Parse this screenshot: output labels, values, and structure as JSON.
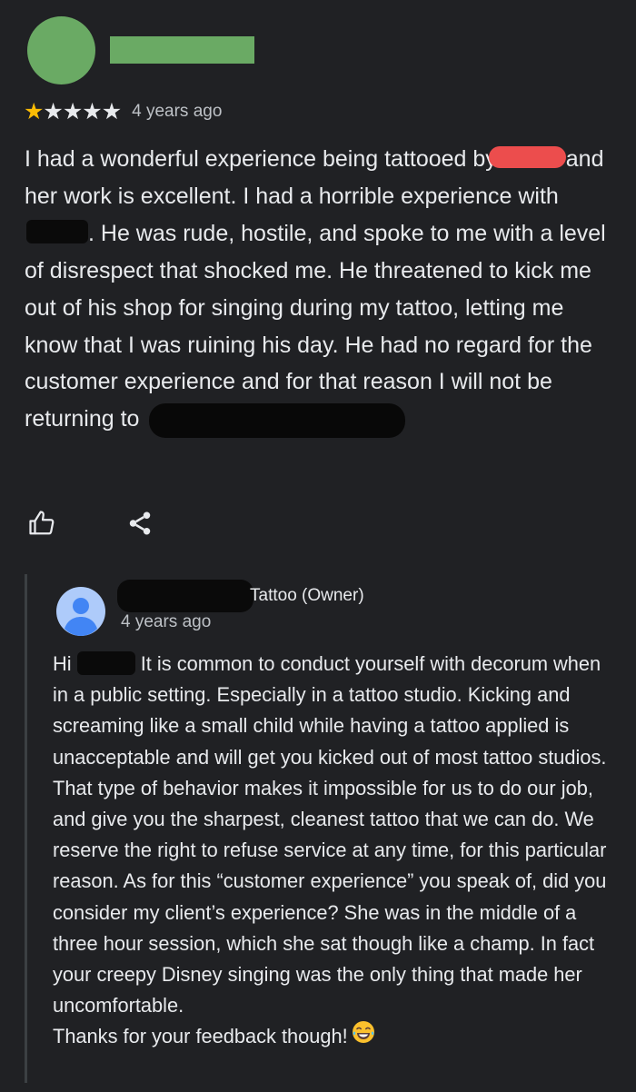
{
  "review": {
    "rating": 1,
    "stars": [
      "★",
      "★",
      "★",
      "★",
      "★"
    ],
    "time": "4 years ago",
    "text_1": "I had a wonderful experience being tattooed by ",
    "text_2": "and her work is excellent. I had a horrible experience with ",
    "text_3": ". He was rude, hostile, and spoke to me with a level of disrespect that shocked me. He threatened to kick me out of his shop for singing during my tattoo, letting me know that I was ruining his day. He had no regard for the customer experience and for that reason I will not be returning to "
  },
  "actions": {
    "like_icon": "thumbs-up-icon",
    "share_icon": "share-icon"
  },
  "reply": {
    "owner_name": "Tattoo (Owner)",
    "time": "4 years ago",
    "greeting": "Hi ",
    "text_1": ". It is common to conduct yourself with decorum when in a public setting. Especially in a tattoo studio. Kicking and screaming like a small child while having a tattoo applied is unacceptable and will get you kicked out of most tattoo studios. That type of behavior makes it impossible for us to do our job, and give you the sharpest, cleanest tattoo that we can do. We reserve the right to refuse service at any time, for this particular reason. As for this “customer experience” you speak of, did you consider my client’s experience? She was in the middle of a three hour session, which she sat though like a champ. In fact your creepy Disney singing was the only thing that made her uncomfortable.",
    "closing": "Thanks for your feedback though!",
    "emoji": "laughing-emoji"
  },
  "colors": {
    "background": "#202124",
    "reviewer_avatar": "#6aaa64",
    "star_filled": "#fbbc04",
    "redaction_red": "#ec4d4d",
    "owner_avatar": "#aecbfa"
  }
}
